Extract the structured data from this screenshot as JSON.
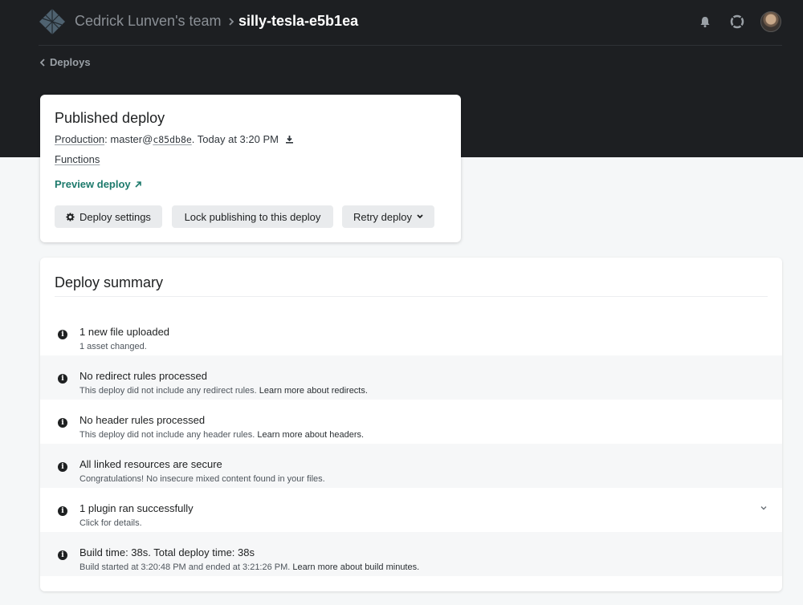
{
  "header": {
    "team_name": "Cedrick Lunven's team",
    "site_name": "silly-tesla-e5b1ea",
    "icons": [
      "netlify-logo-icon",
      "bell-icon",
      "lifebuoy-icon",
      "avatar"
    ]
  },
  "nav": {
    "back_label": "Deploys"
  },
  "published": {
    "title": "Published deploy",
    "context_label": "Production",
    "branch": "master@",
    "commit": "c85db8e",
    "time_text": ". Today at 3:20 PM",
    "functions_label": "Functions",
    "preview_label": "Preview deploy",
    "buttons": {
      "settings": "Deploy settings",
      "lock": "Lock publishing to this deploy",
      "retry": "Retry deploy"
    }
  },
  "summary": {
    "title": "Deploy summary",
    "items": [
      {
        "title": "1 new file uploaded",
        "desc": "1 asset changed.",
        "link": ""
      },
      {
        "title": "No redirect rules processed",
        "desc": "This deploy did not include any redirect rules. ",
        "link": "Learn more about redirects."
      },
      {
        "title": "No header rules processed",
        "desc": "This deploy did not include any header rules. ",
        "link": "Learn more about headers."
      },
      {
        "title": "All linked resources are secure",
        "desc": "Congratulations! No insecure mixed content found in your files.",
        "link": ""
      },
      {
        "title": "1 plugin ran successfully",
        "desc": "Click for details.",
        "link": ""
      },
      {
        "title": "Build time: 38s. Total deploy time: 38s",
        "desc": "Build started at 3:20:48 PM and ended at 3:21:26 PM. ",
        "link": "Learn more about build minutes."
      }
    ]
  },
  "colors": {
    "header_bg": "#1d1f22",
    "accent_teal": "#1d7a6c",
    "button_bg": "#e9ebed",
    "page_bg": "#f5f7f8"
  }
}
